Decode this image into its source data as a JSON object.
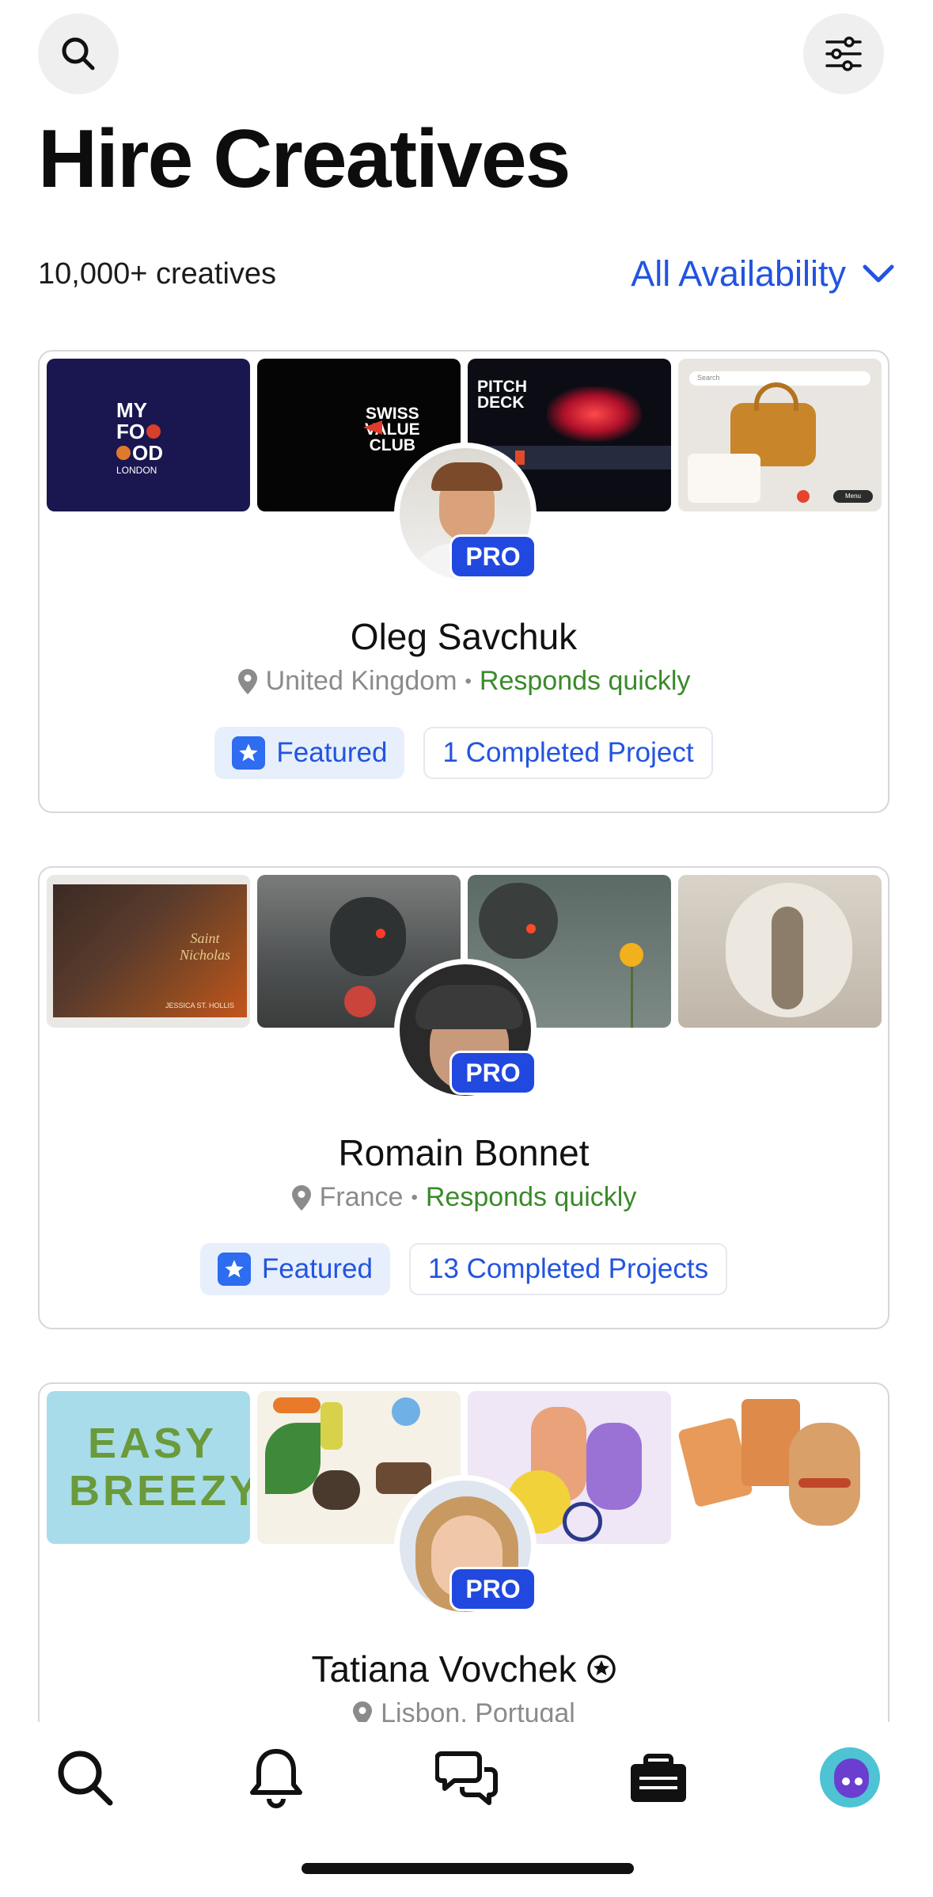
{
  "header": {
    "title": "Hire Creatives",
    "count": "10,000+ creatives",
    "filter_label": "All Availability"
  },
  "creatives": [
    {
      "name": "Oleg Savchuk",
      "location": "United Kingdom",
      "separator": "•",
      "response": "Responds quickly",
      "badge": "PRO",
      "featured": "Featured",
      "projects": "1 Completed Project",
      "thumbs": {
        "t1_a": "MY",
        "t1_b": "FO",
        "t1_c": "OD",
        "t1_d": "LONDON",
        "t2_a": "SWISS",
        "t2_b": "VALUE",
        "t2_c": "CLUB",
        "t3_a": "PITCH",
        "t3_b": "DECK",
        "t4_a": "Search",
        "t4_b": "Menu"
      }
    },
    {
      "name": "Romain Bonnet",
      "location": "France",
      "separator": "•",
      "response": "Responds quickly",
      "badge": "PRO",
      "featured": "Featured",
      "projects": "13 Completed Projects",
      "thumbs": {
        "t1_a": "Saint Nicholas",
        "t1_b": "JESSICA ST. HOLLIS"
      }
    },
    {
      "name": "Tatiana Vovchek",
      "location": "Lisbon, Portugal",
      "badge": "PRO",
      "thumbs": {
        "t1_a": "EASY",
        "t1_b": "BREEZY"
      }
    }
  ],
  "colors": {
    "accent": "#2254e0",
    "pro_badge": "#2149df",
    "green": "#3a8a2a"
  },
  "icons": [
    "search-icon",
    "filter-sliders-icon",
    "chevron-down-icon",
    "location-pin-icon",
    "star-icon",
    "bell-icon",
    "chat-icon",
    "briefcase-icon"
  ]
}
